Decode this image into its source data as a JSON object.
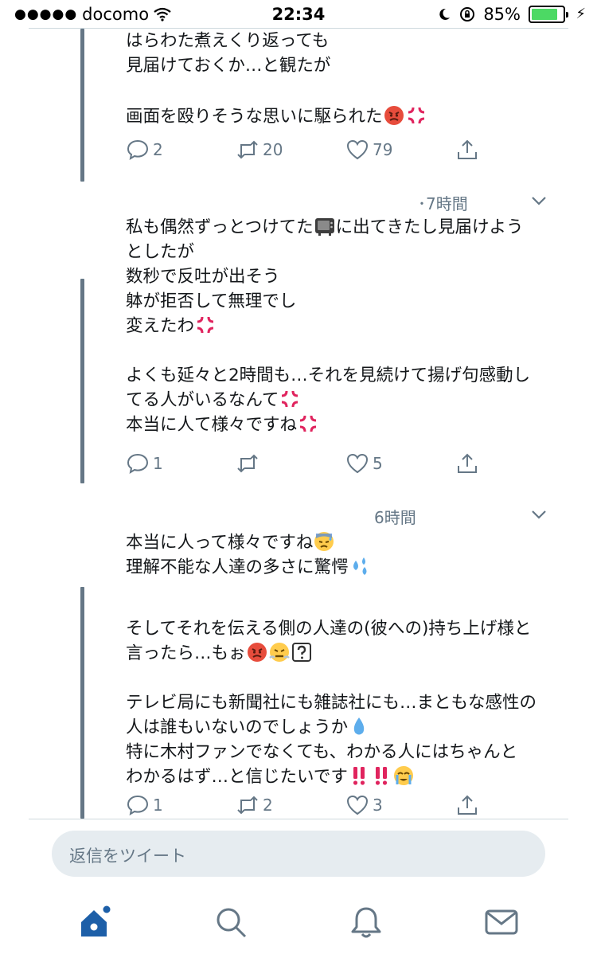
{
  "status_bar": {
    "signal": "●●●●●",
    "carrier": "docomo",
    "time": "22:34",
    "battery_percent": "85%",
    "battery_level": 0.85
  },
  "tweets": [
    {
      "lines": [
        "はらわた煮えくり返っても",
        "見届けておくか…と観たが",
        "",
        "画面を殴りそうな思いに駆られた"
      ],
      "replies": "2",
      "retweets": "20",
      "likes": "79"
    },
    {
      "time": "･7時間",
      "lines": [
        "私も偶然ずっとつけてた",
        "に出てきたし見届けよう",
        "としたが",
        "数秒で反吐が出そう",
        "躰が拒否して無理でし",
        "変えたわ",
        "",
        "よくも延々と2時間も…それを見続けて揚げ句感動し",
        "てる人がいるなんて",
        "本当に人て様々ですね"
      ],
      "replies": "1",
      "retweets": "",
      "likes": "5"
    },
    {
      "time": "6時間",
      "lines": [
        "本当に人って様々ですね",
        "理解不能な人達の多さに驚愕",
        "",
        "そしてそれを伝える側の人達の(彼への)持ち上げ様と",
        "言ったら…もぉ",
        "",
        "テレビ局にも新聞社にも雑誌社にも…まともな感性の",
        "人は誰もいないのでしょうか",
        "特に木村ファンでなくても、わかる人にはちゃんと",
        "わかるはず…と信じたいです"
      ],
      "replies": "1",
      "retweets": "2",
      "likes": "3"
    }
  ],
  "reply_box": {
    "placeholder": "返信をツイート"
  },
  "tab_bar": [
    "home-icon",
    "search-icon",
    "notifications-icon",
    "messages-icon"
  ],
  "colors": {
    "accent": "#1da1f2",
    "tab_active": "#1d5fa8",
    "muted": "#657786",
    "thread": "#657786",
    "battery": "#4cd964"
  }
}
